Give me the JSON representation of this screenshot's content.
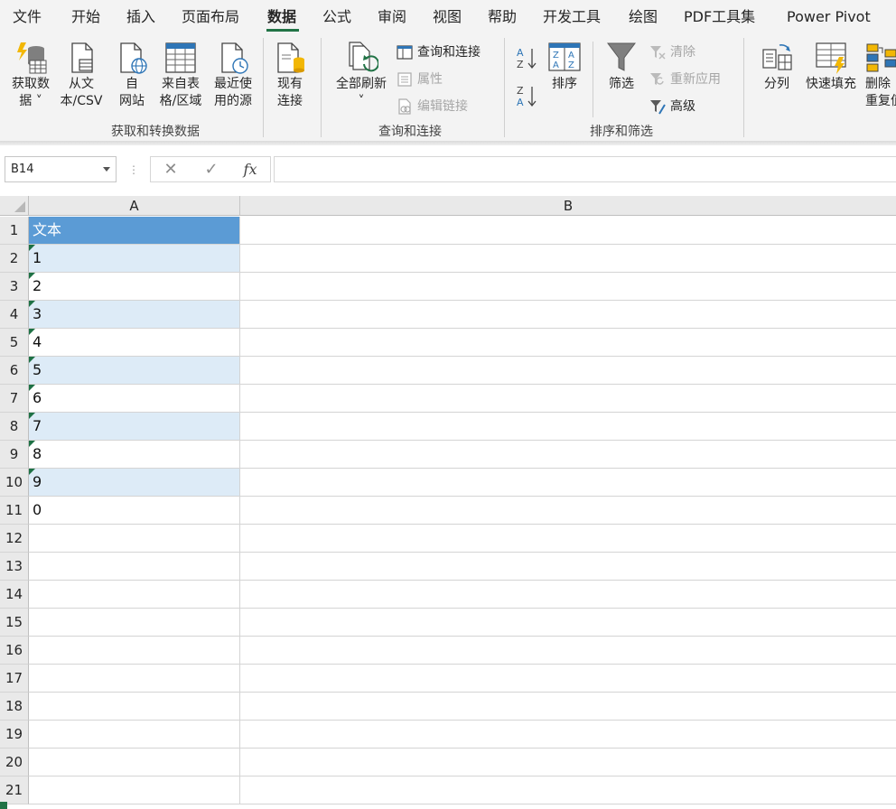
{
  "menu": {
    "tabs": [
      "文件",
      "开始",
      "插入",
      "页面布局",
      "数据",
      "公式",
      "审阅",
      "视图",
      "帮助",
      "开发工具",
      "绘图",
      "PDF工具集",
      "Power Pivot"
    ],
    "active": "数据"
  },
  "ribbon": {
    "get_transform": {
      "group_label": "获取和转换数据",
      "get_data": [
        "获取数",
        "据 ˅"
      ],
      "from_csv": [
        "从文",
        "本/CSV"
      ],
      "from_web": [
        "自",
        "网站"
      ],
      "from_table": [
        "来自表",
        "格/区域"
      ],
      "recent_sources": [
        "最近使",
        "用的源"
      ],
      "existing_connections": [
        "现有",
        "连接"
      ]
    },
    "queries_connections": {
      "group_label": "查询和连接",
      "refresh_all": "全部刷新",
      "refresh_all_arrow": "˅",
      "queries_and_connections": "查询和连接",
      "properties": "属性",
      "edit_links": "编辑链接"
    },
    "sort_filter": {
      "group_label": "排序和筛选",
      "sort": "排序",
      "filter": "筛选",
      "clear": "清除",
      "reapply": "重新应用",
      "advanced": "高级"
    },
    "data_tools": {
      "text_to_columns": "分列",
      "flash_fill": "快速填充",
      "remove_duplicates": [
        "删除",
        "重复值"
      ]
    }
  },
  "formula_bar": {
    "name_box": "B14",
    "dots": "⋮",
    "cancel_glyph": "✕",
    "enter_glyph": "✓",
    "fx_glyph": "fx",
    "formula": ""
  },
  "grid": {
    "columns": [
      "A",
      "B"
    ],
    "rows": [
      {
        "n": "1",
        "a": "文本",
        "style": "header",
        "error": false
      },
      {
        "n": "2",
        "a": "1",
        "style": "band",
        "error": true
      },
      {
        "n": "3",
        "a": "2",
        "style": "plain",
        "error": true
      },
      {
        "n": "4",
        "a": "3",
        "style": "band",
        "error": true
      },
      {
        "n": "5",
        "a": "4",
        "style": "plain",
        "error": true
      },
      {
        "n": "6",
        "a": "5",
        "style": "band",
        "error": true
      },
      {
        "n": "7",
        "a": "6",
        "style": "plain",
        "error": true
      },
      {
        "n": "8",
        "a": "7",
        "style": "band",
        "error": true
      },
      {
        "n": "9",
        "a": "8",
        "style": "plain",
        "error": true
      },
      {
        "n": "10",
        "a": "9",
        "style": "band",
        "error": true
      },
      {
        "n": "11",
        "a": "0",
        "style": "none",
        "error": false
      },
      {
        "n": "12",
        "a": "",
        "style": "none",
        "error": false
      },
      {
        "n": "13",
        "a": "",
        "style": "none",
        "error": false
      },
      {
        "n": "14",
        "a": "",
        "style": "none",
        "error": false
      },
      {
        "n": "15",
        "a": "",
        "style": "none",
        "error": false
      },
      {
        "n": "16",
        "a": "",
        "style": "none",
        "error": false
      },
      {
        "n": "17",
        "a": "",
        "style": "none",
        "error": false
      },
      {
        "n": "18",
        "a": "",
        "style": "none",
        "error": false
      },
      {
        "n": "19",
        "a": "",
        "style": "none",
        "error": false
      },
      {
        "n": "20",
        "a": "",
        "style": "none",
        "error": false
      },
      {
        "n": "21",
        "a": "",
        "style": "none",
        "error": false
      }
    ]
  },
  "colors": {
    "accent": "#217346",
    "table_header_fill": "#5b9bd5",
    "table_band_fill": "#ddebf7",
    "error_marker": "#1e7145"
  }
}
